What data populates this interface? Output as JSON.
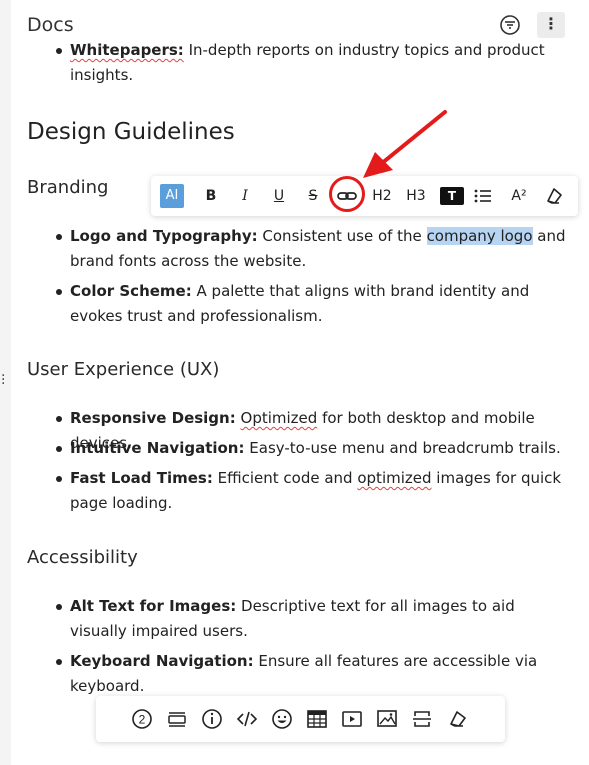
{
  "header": {
    "title": "Docs"
  },
  "content": {
    "whitepapers": {
      "term": "Whitepapers:",
      "text": "In-depth reports on industry topics and product insights."
    },
    "heading": "Design Guidelines",
    "branding": {
      "title": "Branding",
      "items": [
        {
          "term": "Logo and Typography:",
          "before": "Consistent use of the ",
          "highlight": "company logo",
          "after": " and brand fonts across the website."
        },
        {
          "term": "Color Scheme:",
          "text": "A palette that aligns with brand identity and evokes trust and professionalism."
        }
      ]
    },
    "ux": {
      "title": "User Experience (UX)",
      "items": [
        {
          "term": "Responsive Design:",
          "squiggle": "Optimized",
          "text": " for both desktop and mobile devices."
        },
        {
          "term": "Intuitive Navigation:",
          "text": "Easy-to-use menu and breadcrumb trails."
        },
        {
          "term": "Fast Load Times:",
          "before": "Efficient code and ",
          "squiggle": "optimized",
          "after": " images for quick page loading."
        }
      ]
    },
    "accessibility": {
      "title": "Accessibility",
      "items": [
        {
          "term": "Alt Text for Images:",
          "text": "Descriptive text for all images to aid visually impaired users."
        },
        {
          "term": "Keyboard Navigation:",
          "text": "Ensure all features are accessible via keyboard."
        }
      ]
    }
  },
  "format_toolbar": {
    "ai": "AI",
    "bold": "B",
    "italic": "I",
    "underline": "U",
    "strike": "S",
    "h2": "H2",
    "h3": "H3",
    "code": "T",
    "sup": "A²",
    "icons": [
      "link-icon",
      "bullet-list-icon",
      "eraser-icon"
    ]
  },
  "insert_toolbar": {
    "icons": [
      "numbered-circle-icon",
      "layout-icon",
      "info-icon",
      "code-icon",
      "emoji-icon",
      "table-icon",
      "video-icon",
      "image-icon",
      "page-break-icon",
      "eraser-icon"
    ],
    "badge": "2"
  },
  "colors": {
    "accent": "#5a9edb",
    "highlight": "#b7d5f2",
    "annotation": "#e31b1b"
  }
}
